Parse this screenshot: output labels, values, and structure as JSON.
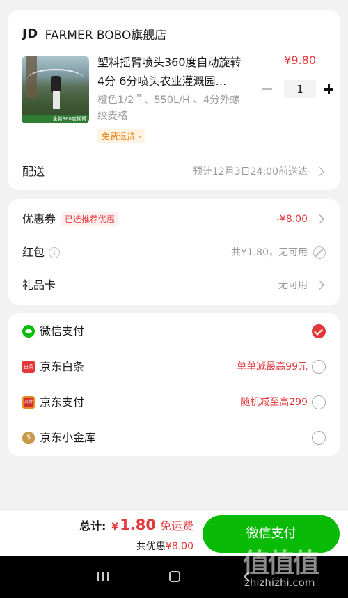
{
  "store": {
    "logo": "JD",
    "name": "FARMER BOBO旗舰店",
    "product": {
      "title": "塑料摇臂喷头360度自动旋转4分 6分喷头农业灌溉园…",
      "price": "¥9.80",
      "spec": "橙色1/2＂、550L/H 、4分外螺纹麦格",
      "quantity": "1",
      "return_tag": "免费退货 ›",
      "image_band_text": "全新360度摇臂"
    },
    "delivery": {
      "label": "配送",
      "value": "预计12月3日24:00前送达"
    }
  },
  "discounts": {
    "coupon": {
      "label": "优惠券",
      "tag": "已选推荐优惠",
      "value": "-¥8.00"
    },
    "red_packet": {
      "label": "红包",
      "value": "共¥1.80，无可用"
    },
    "gift_card": {
      "label": "礼品卡",
      "value": "无可用"
    }
  },
  "payment": {
    "methods": [
      {
        "label": "微信支付",
        "promo": "",
        "selected": true,
        "icon": "wechat-pay-icon"
      },
      {
        "label": "京东白条",
        "promo": "单单减最高99元",
        "selected": false,
        "icon": "baitiao-icon"
      },
      {
        "label": "京东支付",
        "promo": "随机减至高299",
        "selected": false,
        "icon": "jd-pay-icon"
      },
      {
        "label": "京东小金库",
        "promo": "",
        "selected": false,
        "icon": "money-bag-icon"
      }
    ]
  },
  "bottom": {
    "total_label": "总计:",
    "currency": "¥",
    "total_amount": "1.80",
    "free_shipping": "免运费",
    "saved_prefix": "共优惠",
    "saved_amount": "¥8.00",
    "pay_button": "微信支付"
  },
  "watermark": {
    "zh": "值值值",
    "en": "zhizhizhi.com"
  },
  "colors": {
    "accent_red": "#e4393c",
    "wechat_green": "#09bb07",
    "orange": "#e9800d"
  }
}
